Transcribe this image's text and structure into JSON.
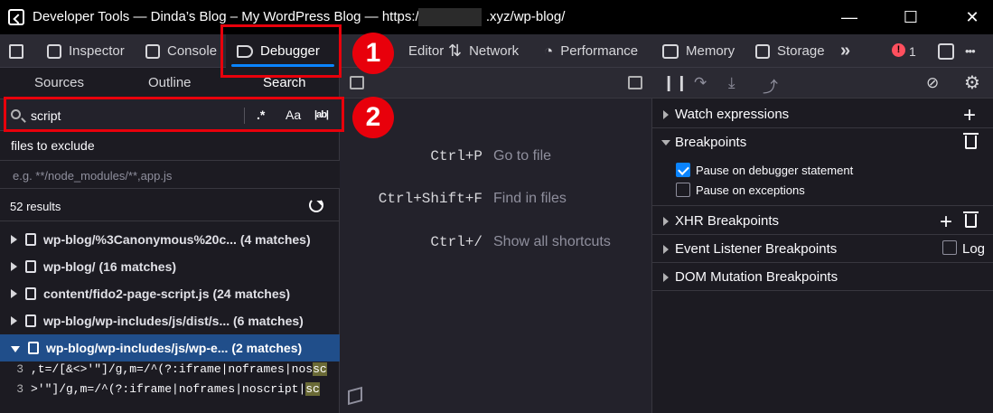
{
  "window": {
    "title": "Developer Tools — Dinda’s Blog – My WordPress Blog — https://",
    "title_suffix": ".xyz/wp-blog/",
    "minimize": "—",
    "maximize": "☐",
    "close": "✕"
  },
  "toolbar": {
    "tabs": [
      {
        "label": "Inspector",
        "icon": "inspector-icon"
      },
      {
        "label": "Console",
        "icon": "console-icon"
      },
      {
        "label": "Debugger",
        "icon": "debugger-icon"
      },
      {
        "label": "Editor",
        "icon": "style-editor-icon"
      },
      {
        "label": "Network",
        "icon": "network-icon"
      },
      {
        "label": "Performance",
        "icon": "performance-icon"
      },
      {
        "label": "Memory",
        "icon": "memory-icon"
      },
      {
        "label": "Storage",
        "icon": "storage-icon"
      }
    ],
    "selected_tab": "Debugger",
    "error_count": "1",
    "more_tools": "»",
    "menu": "•••"
  },
  "sources_panel": {
    "subtabs": [
      "Sources",
      "Outline",
      "Search"
    ],
    "active_subtab": "Search",
    "search": {
      "value": "script",
      "regex_label": ".*",
      "case_label": "Aa",
      "whole_word_label": "|ab|"
    },
    "exclude": {
      "label": "files to exclude",
      "placeholder": "e.g. **/node_modules/**,app.js"
    },
    "results_count": "52 results",
    "results": [
      {
        "file": "wp-blog/%3Canonymous%20c...",
        "matches": "(4 matches)"
      },
      {
        "file": "wp-blog/",
        "matches": "(16 matches)"
      },
      {
        "file": "content/fido2-page-script.js",
        "matches": "(24 matches)"
      },
      {
        "file": "wp-blog/wp-includes/js/dist/s...",
        "matches": "(6 matches)"
      },
      {
        "file": "wp-blog/wp-includes/js/wp-e...",
        "matches": "(2 matches)"
      }
    ],
    "lines": [
      {
        "num": "3",
        "text": ",t=/[&<>'\"]/g,m=/^(?:iframe|noframes|nos",
        "match": "sc"
      },
      {
        "num": "3",
        "text": ">'\"]/g,m=/^(?:iframe|noframes|noscript|",
        "match": "sc"
      }
    ]
  },
  "editor": {
    "shortcuts": [
      {
        "key": "Ctrl+P",
        "desc": "Go to file"
      },
      {
        "key": "Ctrl+Shift+F",
        "desc": "Find in files"
      },
      {
        "key": "Ctrl+/",
        "desc": "Show all shortcuts"
      }
    ]
  },
  "debugger_panel": {
    "sections": {
      "watch": "Watch expressions",
      "breakpoints": "Breakpoints",
      "xhr": "XHR Breakpoints",
      "event": "Event Listener Breakpoints",
      "dom": "DOM Mutation Breakpoints"
    },
    "pause_debugger": "Pause on debugger statement",
    "pause_exceptions": "Pause on exceptions",
    "log_label": "Log"
  },
  "annotations": {
    "one": "1",
    "two": "2"
  },
  "colors": {
    "accent": "#0a84ff",
    "annotation_red": "#e8000b",
    "selected_row": "#204e8a"
  }
}
